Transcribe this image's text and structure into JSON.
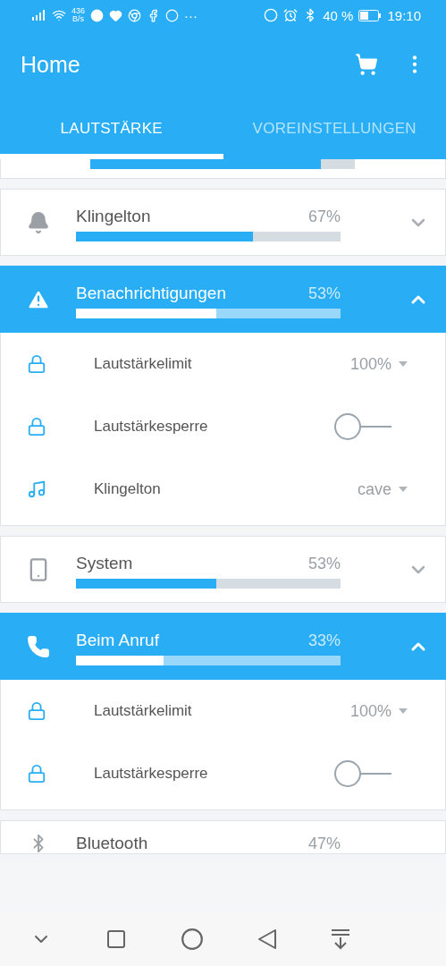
{
  "status_bar": {
    "speed_value": "436",
    "speed_unit": "B/s",
    "more": "···",
    "battery": "40 %",
    "time": "19:10"
  },
  "app_bar": {
    "title": "Home"
  },
  "tabs": [
    {
      "label": "LAUTSTÄRKE",
      "selected": true
    },
    {
      "label": "VOREINSTELLUNGEN",
      "selected": false
    }
  ],
  "channels": [
    {
      "kind": "partial",
      "level": 0.87
    },
    {
      "kind": "channel",
      "name": "Klingelton",
      "percent": "67%",
      "level": 0.67,
      "expanded": false
    },
    {
      "kind": "channel",
      "name": "Benachrichtigungen",
      "percent": "53%",
      "level": 0.53,
      "expanded": true,
      "settings": [
        {
          "kind": "limit",
          "label": "Lautstärkelimit",
          "value": "100%"
        },
        {
          "kind": "lock",
          "label": "Lautstärkesperre",
          "on": false
        },
        {
          "kind": "tone",
          "label": "Klingelton",
          "value": "cave"
        }
      ]
    },
    {
      "kind": "channel",
      "name": "System",
      "percent": "53%",
      "level": 0.53,
      "expanded": false
    },
    {
      "kind": "channel",
      "name": "Beim Anruf",
      "percent": "33%",
      "level": 0.33,
      "expanded": true,
      "settings": [
        {
          "kind": "limit",
          "label": "Lautstärkelimit",
          "value": "100%"
        },
        {
          "kind": "lock",
          "label": "Lautstärkesperre",
          "on": false
        }
      ]
    },
    {
      "kind": "cut",
      "name": "Bluetooth",
      "percent": "47%"
    }
  ]
}
